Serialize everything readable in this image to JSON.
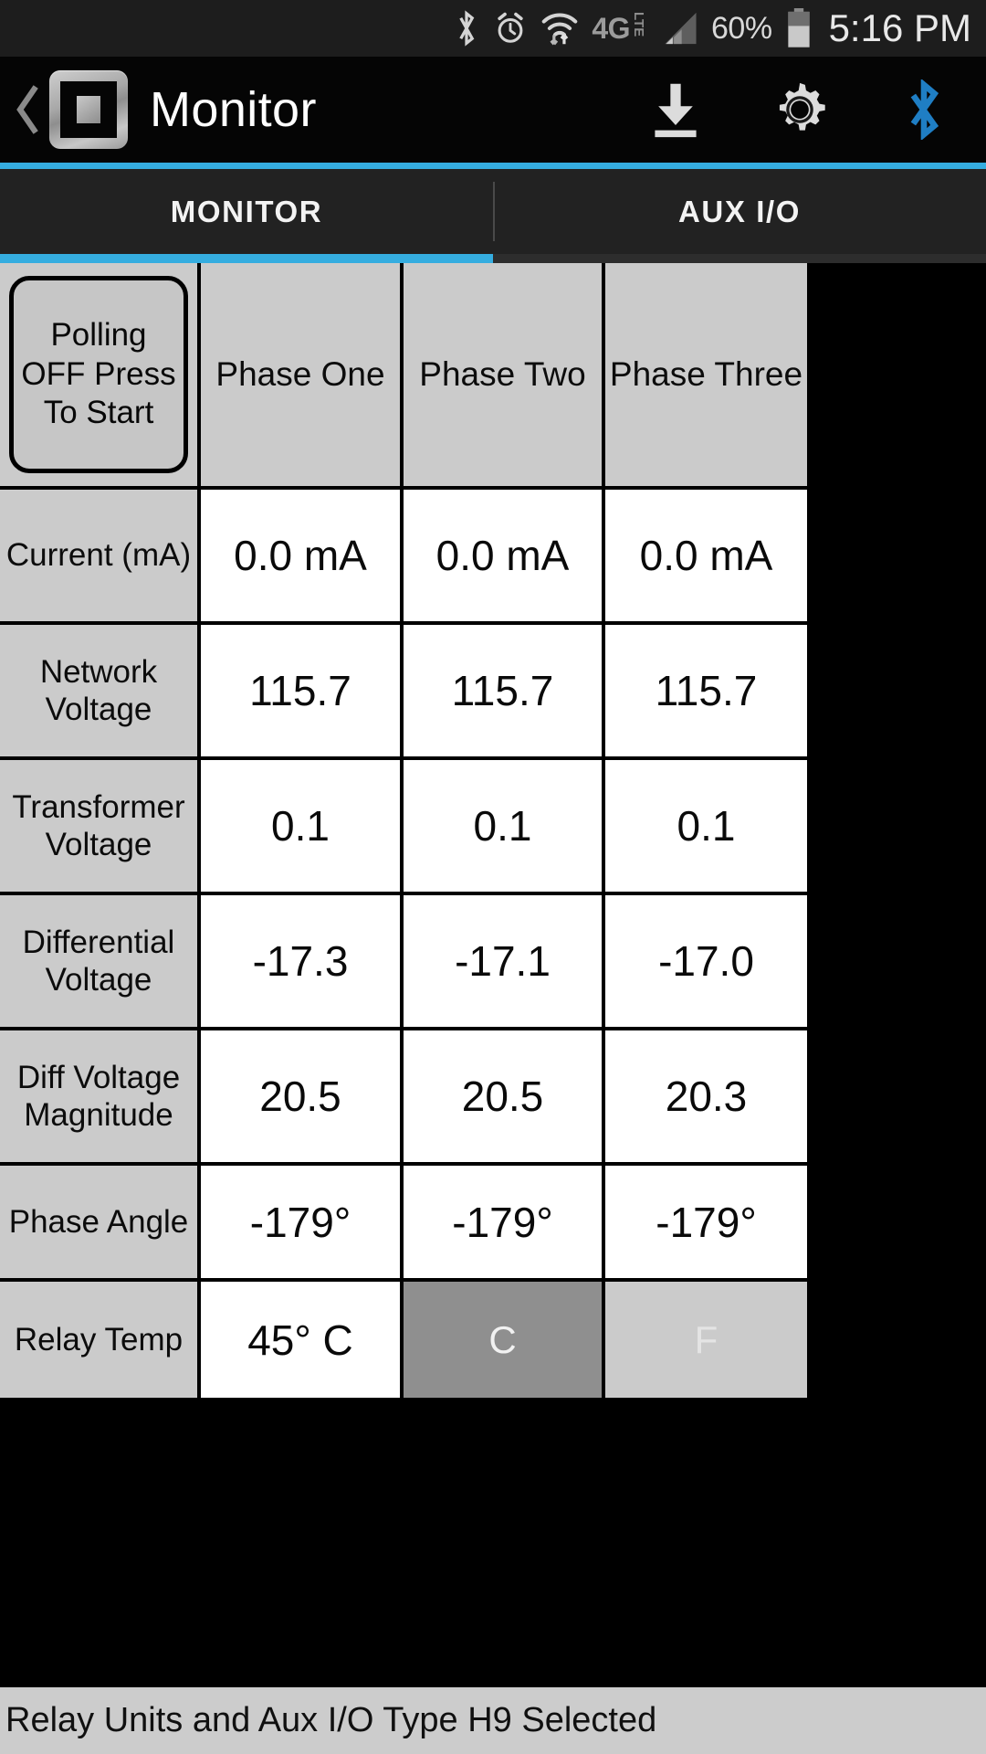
{
  "status_bar": {
    "icons": [
      "bluetooth-icon",
      "alarm-clock-icon",
      "wifi-icon",
      "4g-lte-icon",
      "cellular-signal-icon"
    ],
    "network_label": "4G",
    "network_sublabel": "LTE",
    "battery_percent": "60%",
    "clock": "5:16 PM"
  },
  "action_bar": {
    "back_label": "‹",
    "title": "Monitor",
    "icons": [
      "download-icon",
      "gear-icon",
      "bluetooth-icon"
    ],
    "bluetooth_color": "#1f7ec4"
  },
  "tabs": {
    "items": [
      {
        "label": "MONITOR",
        "active": true
      },
      {
        "label": "AUX I/O",
        "active": false
      }
    ],
    "accent_color": "#35ade0"
  },
  "table": {
    "polling_button": "Polling OFF Press To Start",
    "column_headers": [
      "",
      "Phase One",
      "Phase Two",
      "Phase Three"
    ],
    "rows": [
      {
        "label": "Current (mA)",
        "values": [
          "0.0 mA",
          "0.0 mA",
          "0.0 mA"
        ]
      },
      {
        "label": "Network Voltage",
        "values": [
          "115.7",
          "115.7",
          "115.7"
        ]
      },
      {
        "label": "Transformer Voltage",
        "values": [
          "0.1",
          "0.1",
          "0.1"
        ]
      },
      {
        "label": "Differential Voltage",
        "values": [
          "-17.3",
          "-17.1",
          "-17.0"
        ]
      },
      {
        "label": "Diff Voltage Magnitude",
        "values": [
          "20.5",
          "20.5",
          "20.3"
        ]
      },
      {
        "label": "Phase Angle",
        "values": [
          "-179°",
          "-179°",
          "-179°"
        ]
      }
    ],
    "temp_row": {
      "label": "Relay Temp",
      "value": "45° C",
      "unit_celsius": "C",
      "unit_fahrenheit": "F",
      "selected_unit": "C"
    }
  },
  "footer": {
    "status_text": "Relay Units and Aux I/O Type H9 Selected"
  }
}
